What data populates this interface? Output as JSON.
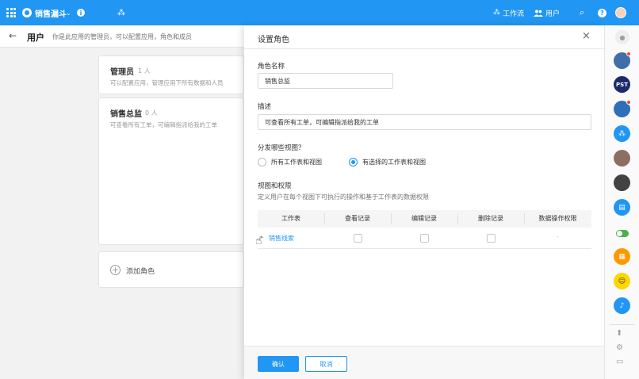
{
  "colors": {
    "primary": "#2196f3",
    "link": "#2196f3",
    "badge": "#f44336"
  },
  "topbar": {
    "app_name": "销售漏斗",
    "chevron": "⌄",
    "info": "i",
    "dist_icon": "⁂",
    "worksheet_icon": "⁂",
    "worksheet_label": "工作流",
    "users_label": "用户",
    "search_icon": "⌕",
    "help": "?"
  },
  "users_header": {
    "back": "←",
    "title": "用户",
    "desc": "你是此应用的管理员，可以配置应用，角色和成员"
  },
  "roles": [
    {
      "name": "管理员",
      "count": "1 人",
      "desc": "可以配置应用，管理应用下所有数据和人员"
    },
    {
      "name": "销售总监",
      "count": "0 人",
      "desc": "可查看所有工单，可编辑指派给我的工单"
    }
  ],
  "add_role": {
    "plus": "+",
    "label": "添加角色"
  },
  "panel": {
    "title": "设置角色",
    "close": "×",
    "role_name_label": "角色名称",
    "role_name_value": "销售总监",
    "desc_label": "描述",
    "desc_value": "可查看所有工单，可编辑指派给我的工单",
    "dist_label": "分发哪些视图？",
    "radio_all": "所有工作表和视图",
    "radio_selected": "有选择的工作表和视图",
    "perm_label": "视图和权限",
    "perm_help": "定义用户在每个视图下可执行的操作和基于工作表的数据权限",
    "table": {
      "headers": [
        "工作表",
        "查看记录",
        "编辑记录",
        "删除记录",
        "数据操作权限"
      ],
      "rows": [
        {
          "name": "销售线索",
          "expand": "▸",
          "dash": "-"
        }
      ]
    },
    "cursor": "☝",
    "ok": "确认",
    "cancel": "取消"
  },
  "sidebar": {
    "items": [
      "bell",
      "avatar",
      "PST",
      "globe",
      "org",
      "person",
      "person-dark",
      "message",
      "toggle",
      "calendar",
      "smiley",
      "notification"
    ],
    "pst": "PST",
    "bottom_icons": [
      "⬆",
      "⚙",
      "▭"
    ]
  }
}
